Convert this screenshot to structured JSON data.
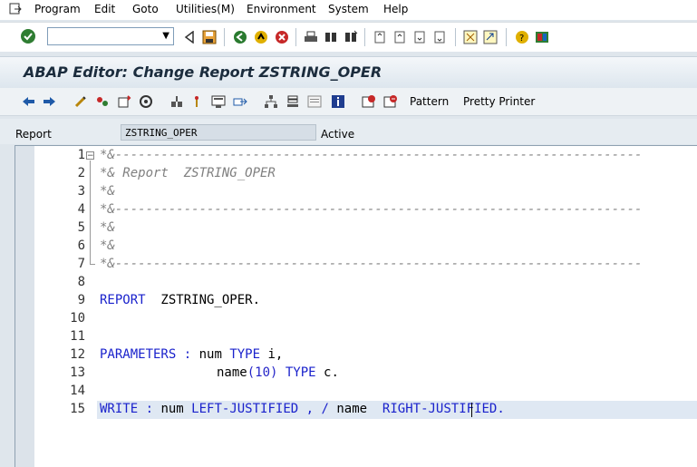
{
  "menu": [
    "Program",
    "Edit",
    "Goto",
    "Utilities(M)",
    "Environment",
    "System",
    "Help"
  ],
  "title": "ABAP Editor: Change Report ZSTRING_OPER",
  "app_toolbar": {
    "pattern": "Pattern",
    "pretty_printer": "Pretty Printer"
  },
  "report_row": {
    "label": "Report",
    "value": "ZSTRING_OPER",
    "status": "Active"
  },
  "line_numbers": [
    "1",
    "2",
    "3",
    "4",
    "5",
    "6",
    "7",
    "8",
    "9",
    "10",
    "11",
    "12",
    "13",
    "14",
    "15"
  ],
  "code": {
    "l1": "*&---------------------------------------------------------------------",
    "l2": "*& Report  ZSTRING_OPER",
    "l3": "*&",
    "l4": "*&---------------------------------------------------------------------",
    "l5": "*&",
    "l6": "*&",
    "l7": "*&---------------------------------------------------------------------",
    "l9_kw": "REPORT",
    "l9_rest": "  ZSTRING_OPER.",
    "l12_kw": "PARAMETERS",
    "l12_op": " : ",
    "l12_a": "num ",
    "l12_kw2": "TYPE",
    "l12_b": " i,",
    "l13_a": "name",
    "l13_p": "(10)",
    "l13_kw": " TYPE",
    "l13_b": " c.",
    "l15_kw": "WRITE",
    "l15_op": " : ",
    "l15_a": "num ",
    "l15_kw2": "LEFT-JUSTIFIED",
    "l15_b": " , / ",
    "l15_c": "name  ",
    "l15_kw3": "RIGHT-JUSTIFIED",
    "l15_end": "."
  }
}
